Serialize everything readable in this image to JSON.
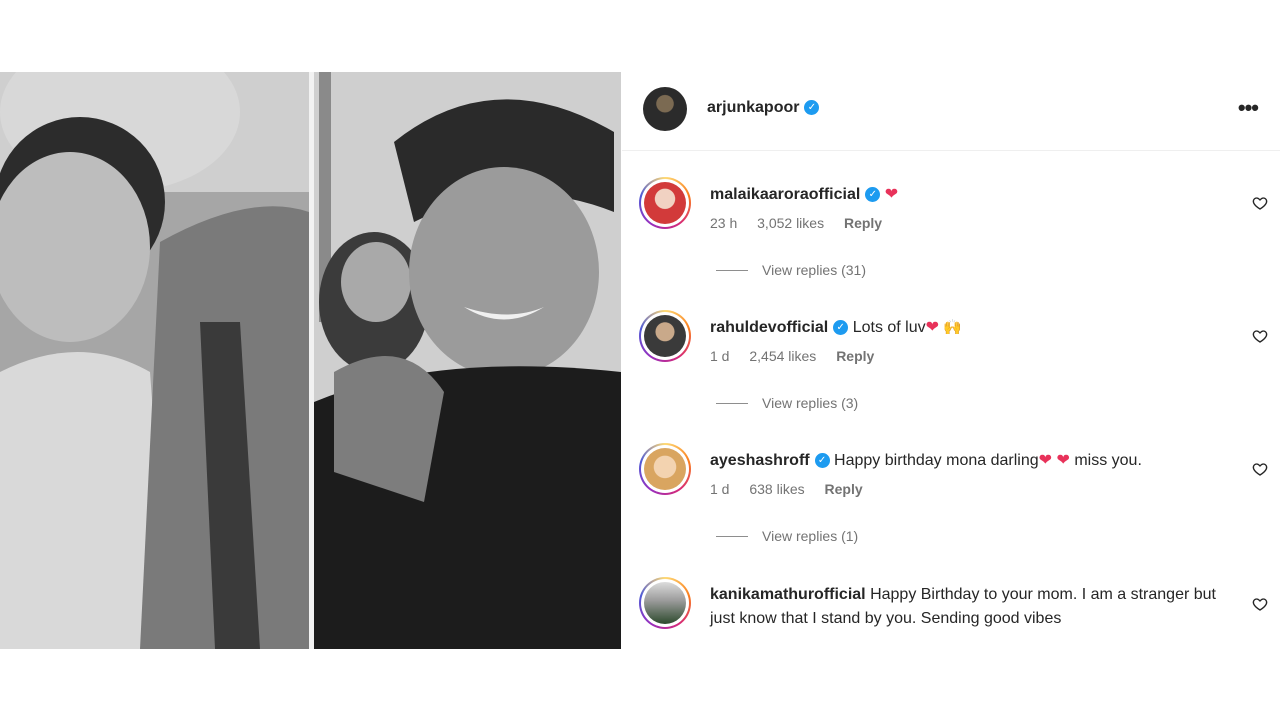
{
  "post": {
    "author": "arjunkapoor",
    "more_icon": "more-horizontal-icon"
  },
  "comments": [
    {
      "username": "malaikaaroraofficial",
      "text": "",
      "emoji": "❤",
      "time": "23 h",
      "likes": "3,052 likes",
      "reply": "Reply",
      "view_replies": "View replies (31)"
    },
    {
      "username": "rahuldevofficial",
      "text": "Lots of luv",
      "emoji": "❤",
      "emoji2": "🙌",
      "time": "1 d",
      "likes": "2,454 likes",
      "reply": "Reply",
      "view_replies": "View replies (3)"
    },
    {
      "username": "ayeshashroff",
      "text": "Happy birthday mona darling",
      "emoji": "❤ ❤",
      "text2": "miss you.",
      "time": "1 d",
      "likes": "638 likes",
      "reply": "Reply",
      "view_replies": "View replies (1)"
    },
    {
      "username": "kanikamathurofficial",
      "text": "Happy Birthday to your mom. I am a stranger but just know that I stand by you. Sending good vibes"
    }
  ],
  "colors": {
    "verified": "#1d9bf0",
    "heart": "#e8325a",
    "meta_text": "#737373"
  }
}
